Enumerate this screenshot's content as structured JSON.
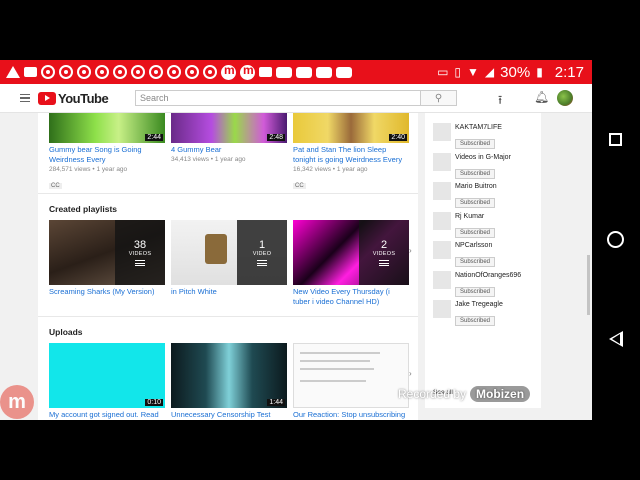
{
  "status_bar": {
    "battery": "30%",
    "time": "2:17"
  },
  "header": {
    "logo_text": "YouTube",
    "search_placeholder": "Search"
  },
  "top_videos": [
    {
      "title": "Gummy bear Song is Going Weirdness Every",
      "meta": "284,571 views  •  1 year ago",
      "duration": "2:44",
      "badge": "CC"
    },
    {
      "title": "4 Gummy Bear",
      "meta": "34,413 views  •  1 year ago",
      "duration": "2:48",
      "badge": ""
    },
    {
      "title": "Pat and Stan The lion Sleep tonight is going Weirdness Every",
      "meta": "16,342 views  •  1 year ago",
      "duration": "2:40",
      "badge": "CC"
    }
  ],
  "playlists_section": {
    "title": "Created playlists",
    "items": [
      {
        "title": "Screaming Sharks (My Version)",
        "count": "38",
        "label": "VIDEOS"
      },
      {
        "title": "in Pitch White",
        "count": "1",
        "label": "VIDEO"
      },
      {
        "title": "New Video Every Thursday (i tuber i video Channel HD)",
        "count": "2",
        "label": "VIDEOS"
      }
    ]
  },
  "uploads_section": {
    "title": "Uploads",
    "items": [
      {
        "title": "My account got signed out. Read",
        "duration": "0:10"
      },
      {
        "title": "Unnecessary Censorship Test",
        "duration": "1:44"
      },
      {
        "title": "Our Reaction: Stop unsubscribing",
        "duration": ""
      }
    ]
  },
  "subscriptions": {
    "channels": [
      {
        "name": "KAKTAM7LIFE",
        "button": "Subscribed"
      },
      {
        "name": "Videos in G-Major",
        "button": "Subscribed"
      },
      {
        "name": "Mario Buitron",
        "button": "Subscribed"
      },
      {
        "name": "Rj Kumar",
        "button": "Subscribed"
      },
      {
        "name": "NPCarlsson",
        "button": "Subscribed"
      },
      {
        "name": "NationOfOranges696",
        "button": "Subscribed"
      },
      {
        "name": "Jake Tregeagle",
        "button": "Subscribed"
      }
    ],
    "see_all": "See all"
  },
  "watermark": {
    "recorded_by": "Recorded by",
    "brand": "Mobizen"
  },
  "colors": {
    "status_bar": "#e8101a",
    "link": "#1a6fd4",
    "youtube_red": "#e8101a"
  },
  "icons": [
    "menu-icon",
    "search-icon",
    "upload-icon",
    "bell-icon",
    "avatar",
    "chrome-icon",
    "wifi-icon",
    "battery-icon",
    "square-nav-icon",
    "circle-nav-icon",
    "back-nav-icon"
  ]
}
